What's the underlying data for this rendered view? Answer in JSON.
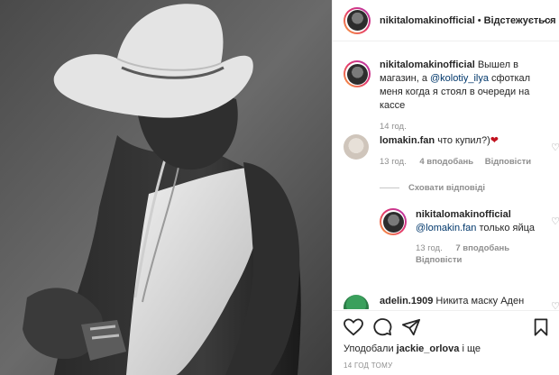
{
  "header": {
    "username": "nikitalomakinofficial",
    "dot": "•",
    "follow_status": "Відстежується",
    "more": "···"
  },
  "caption": {
    "username": "nikitalomakinofficial",
    "text_before": "Вышел в магазин, а",
    "mention": "@kolotiy_ilya",
    "text_after": "сфоткал меня когда я стоял в очереди на кассе",
    "time": "14 год."
  },
  "comments": [
    {
      "username": "lomakin.fan",
      "text": "что купил?)",
      "emoji": "❤",
      "time": "13 год.",
      "likes": "4 вподобань",
      "reply_label": "Відповісти"
    },
    {
      "username": "adelin.1909",
      "text": "Никита маску Аден"
    }
  ],
  "hide_replies": "Сховати відповіді",
  "reply": {
    "username": "nikitalomakinofficial",
    "mention": "@lomakin.fan",
    "text": "только яйца",
    "time": "13 год.",
    "likes": "7 вподобань",
    "reply_label": "Відповісти"
  },
  "likes_summary": {
    "prefix": "Уподобали",
    "user": "jackie_orlova",
    "suffix": "і ще"
  },
  "post_time": "14 ГОД ТОМУ",
  "colors": {
    "heart_emoji": "#c1121f",
    "muted": "#8e8e8e",
    "mention": "#00376b"
  }
}
